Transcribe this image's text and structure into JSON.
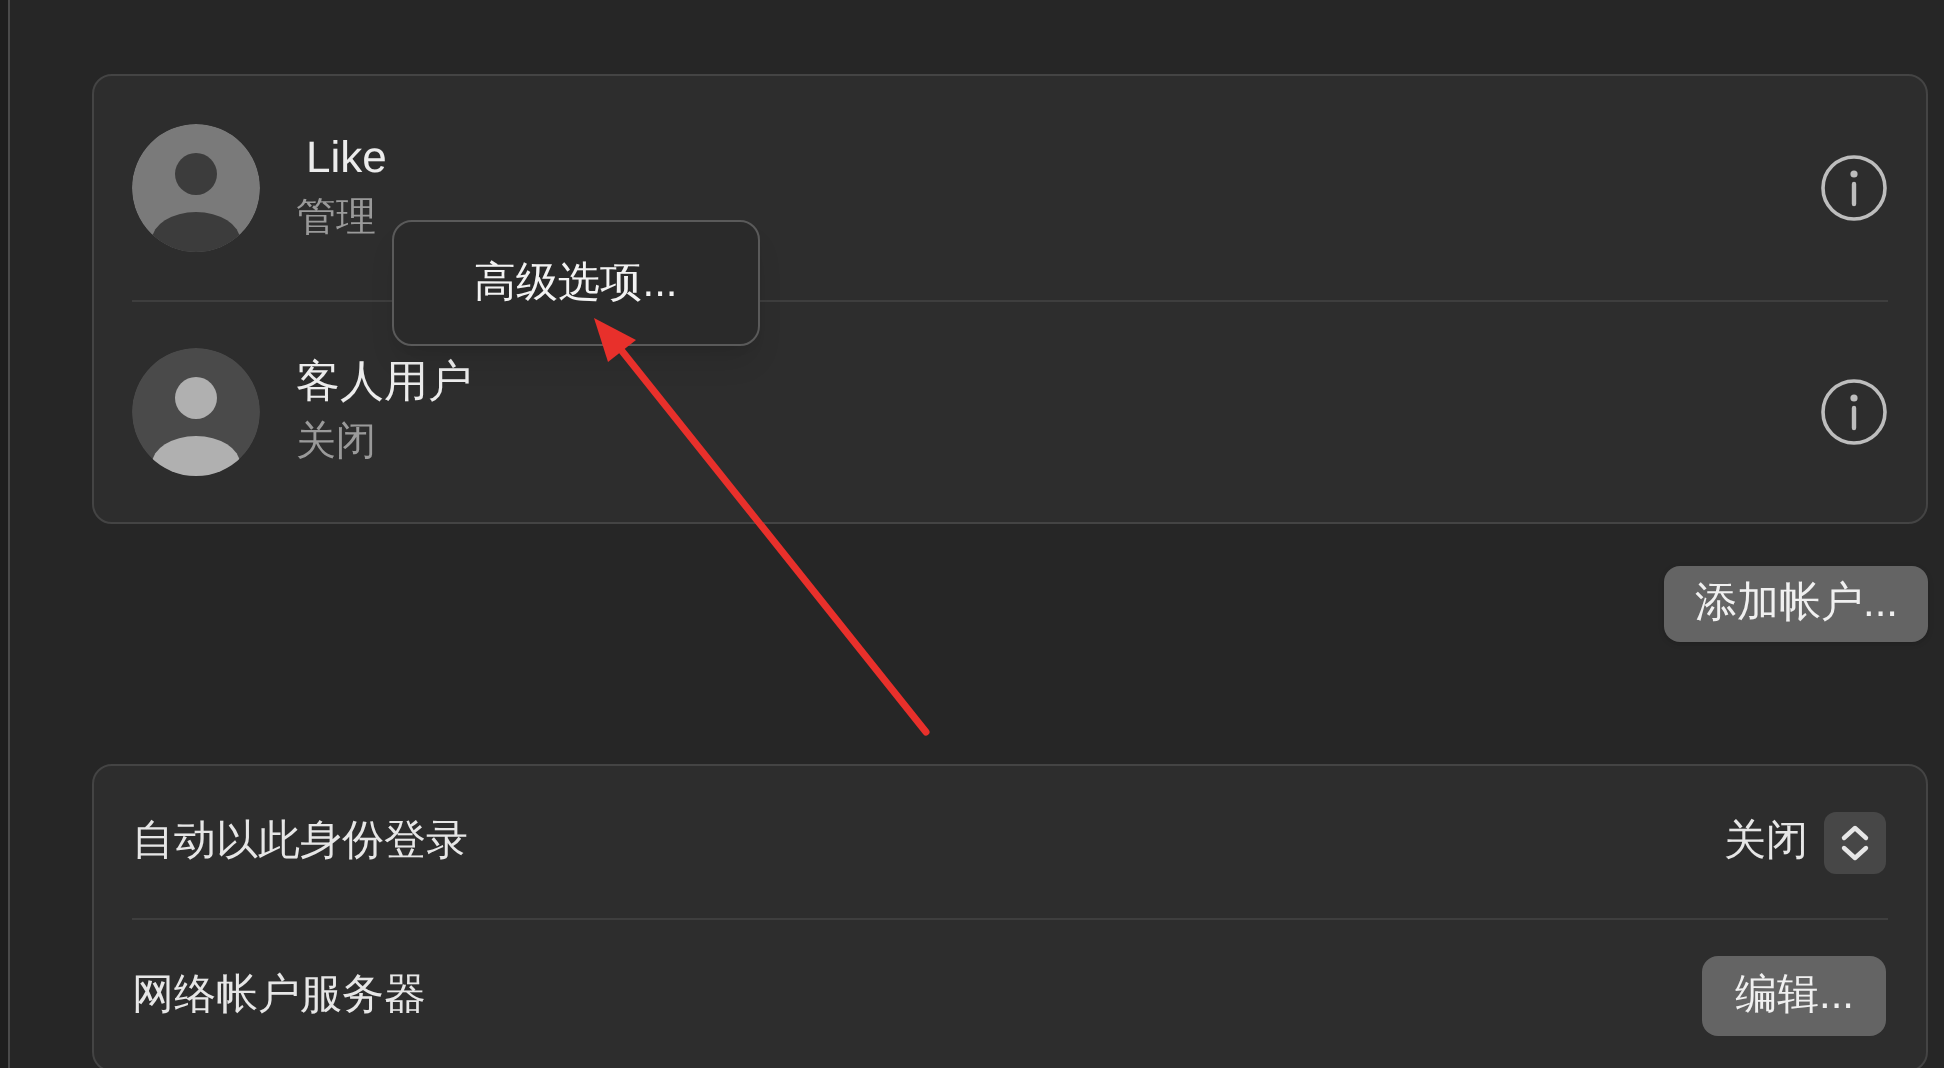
{
  "accounts": [
    {
      "name": "Like",
      "subtitle": "管理",
      "kind": "user"
    },
    {
      "name": "客人用户",
      "subtitle": "关闭",
      "kind": "guest"
    }
  ],
  "popup_menu": {
    "items": [
      "高级选项..."
    ]
  },
  "add_account_button": "添加帐户...",
  "settings": [
    {
      "kind": "popup",
      "label": "自动以此身份登录",
      "value": "关闭"
    },
    {
      "kind": "button",
      "label": "网络帐户服务器",
      "button": "编辑..."
    }
  ]
}
